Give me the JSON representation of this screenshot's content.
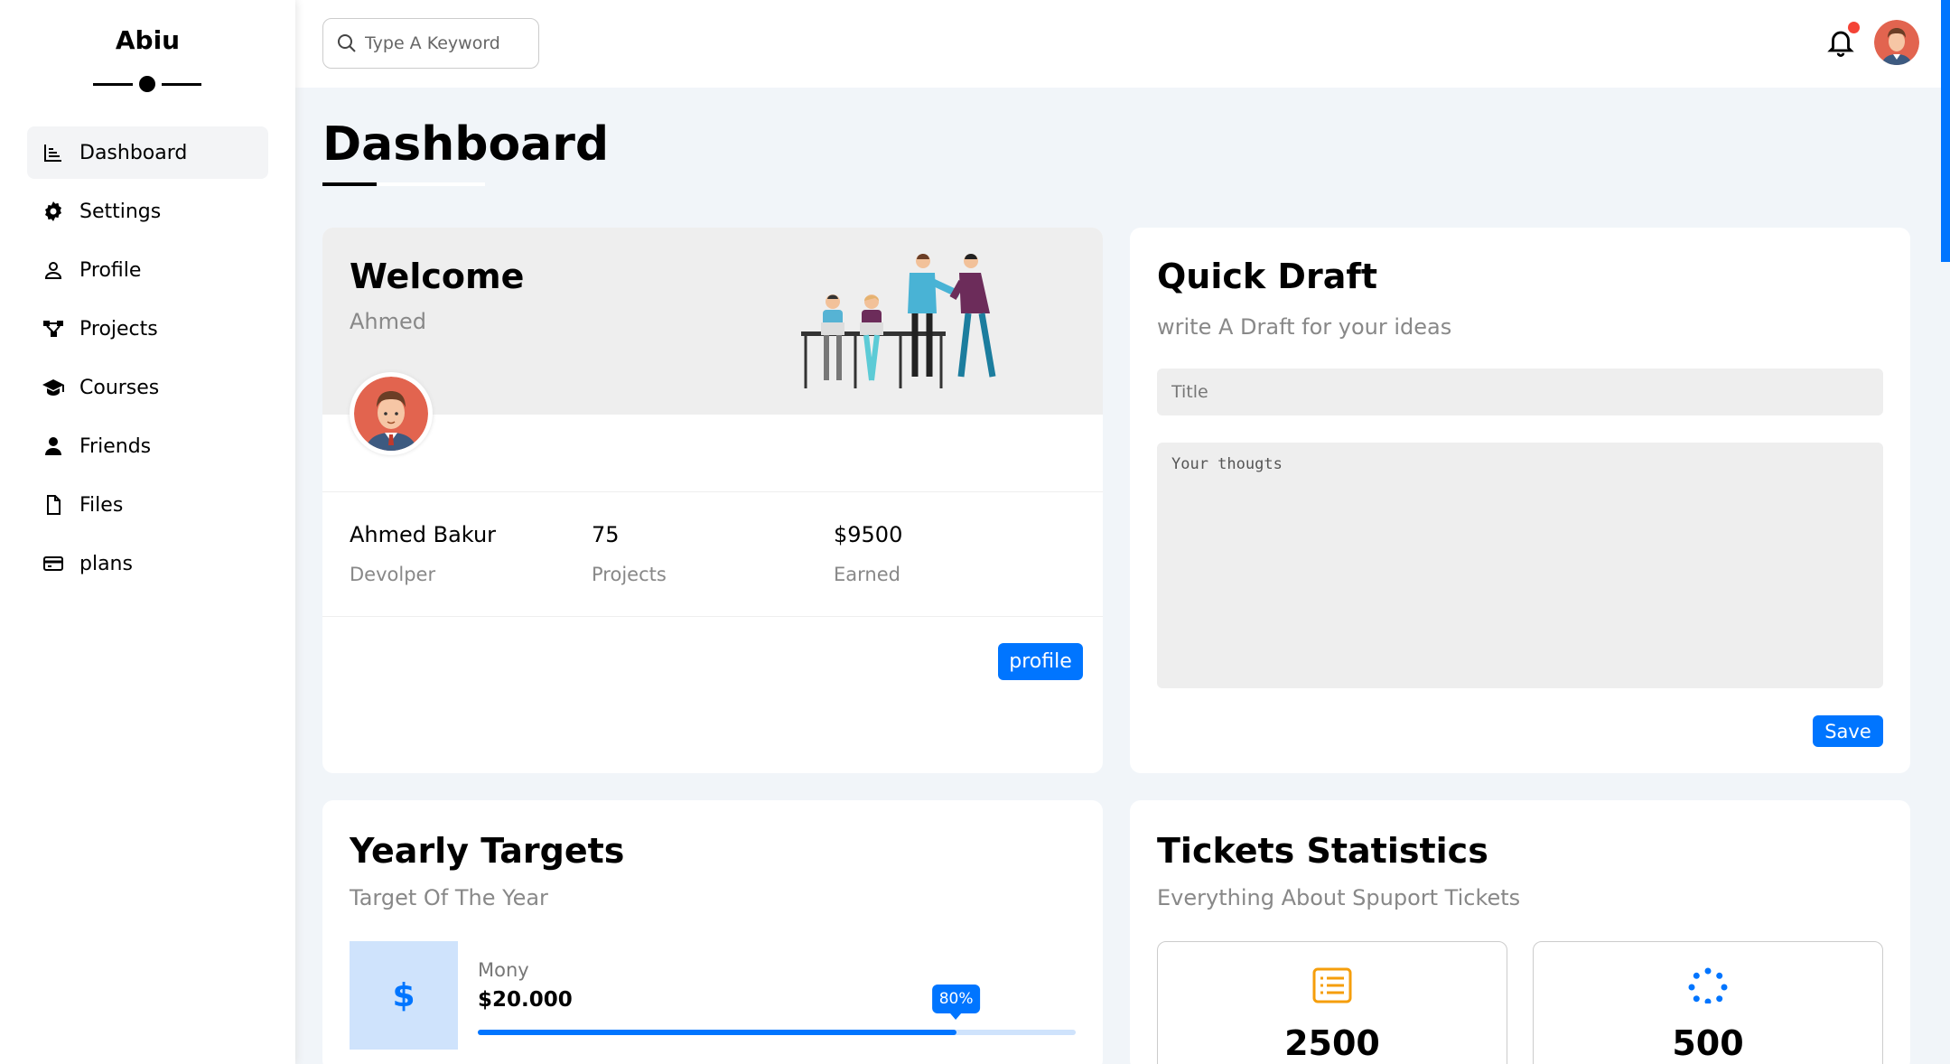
{
  "app": {
    "brand": "Abiu"
  },
  "sidebar": {
    "items": [
      {
        "label": "Dashboard",
        "icon": "chart-icon",
        "active": true
      },
      {
        "label": "Settings",
        "icon": "gear-icon"
      },
      {
        "label": "Profile",
        "icon": "user-outline-icon"
      },
      {
        "label": "Projects",
        "icon": "diagram-icon"
      },
      {
        "label": "Courses",
        "icon": "graduation-cap-icon"
      },
      {
        "label": "Friends",
        "icon": "user-icon"
      },
      {
        "label": "Files",
        "icon": "file-icon"
      },
      {
        "label": "plans",
        "icon": "credit-card-icon"
      }
    ]
  },
  "header": {
    "search_placeholder": "Type A Keyword",
    "has_notification": true
  },
  "page": {
    "title": "Dashboard"
  },
  "welcome": {
    "title": "Welcome",
    "name": "Ahmed",
    "stats": [
      {
        "value": "Ahmed Bakur",
        "label": "Devolper"
      },
      {
        "value": "75",
        "label": "Projects"
      },
      {
        "value": "$9500",
        "label": "Earned"
      }
    ],
    "button": "profile"
  },
  "draft": {
    "title": "Quick Draft",
    "subtitle": "write A Draft for your ideas",
    "title_placeholder": "Title",
    "text_placeholder": "Your thougts",
    "button": "Save"
  },
  "targets": {
    "title": "Yearly Targets",
    "subtitle": "Target Of The Year",
    "items": [
      {
        "icon": "$",
        "label": "Mony",
        "value": "$20.000",
        "progress": 80,
        "badge": "80%"
      }
    ]
  },
  "tickets": {
    "title": "Tickets Statistics",
    "subtitle": "Everything About Spuport Tickets",
    "items": [
      {
        "icon": "list-icon",
        "value": "2500",
        "color": "#f59e0b"
      },
      {
        "icon": "spinner-icon",
        "value": "500",
        "color": "#0075ff"
      }
    ]
  },
  "colors": {
    "accent": "#0075ff",
    "notification": "#f44336"
  }
}
